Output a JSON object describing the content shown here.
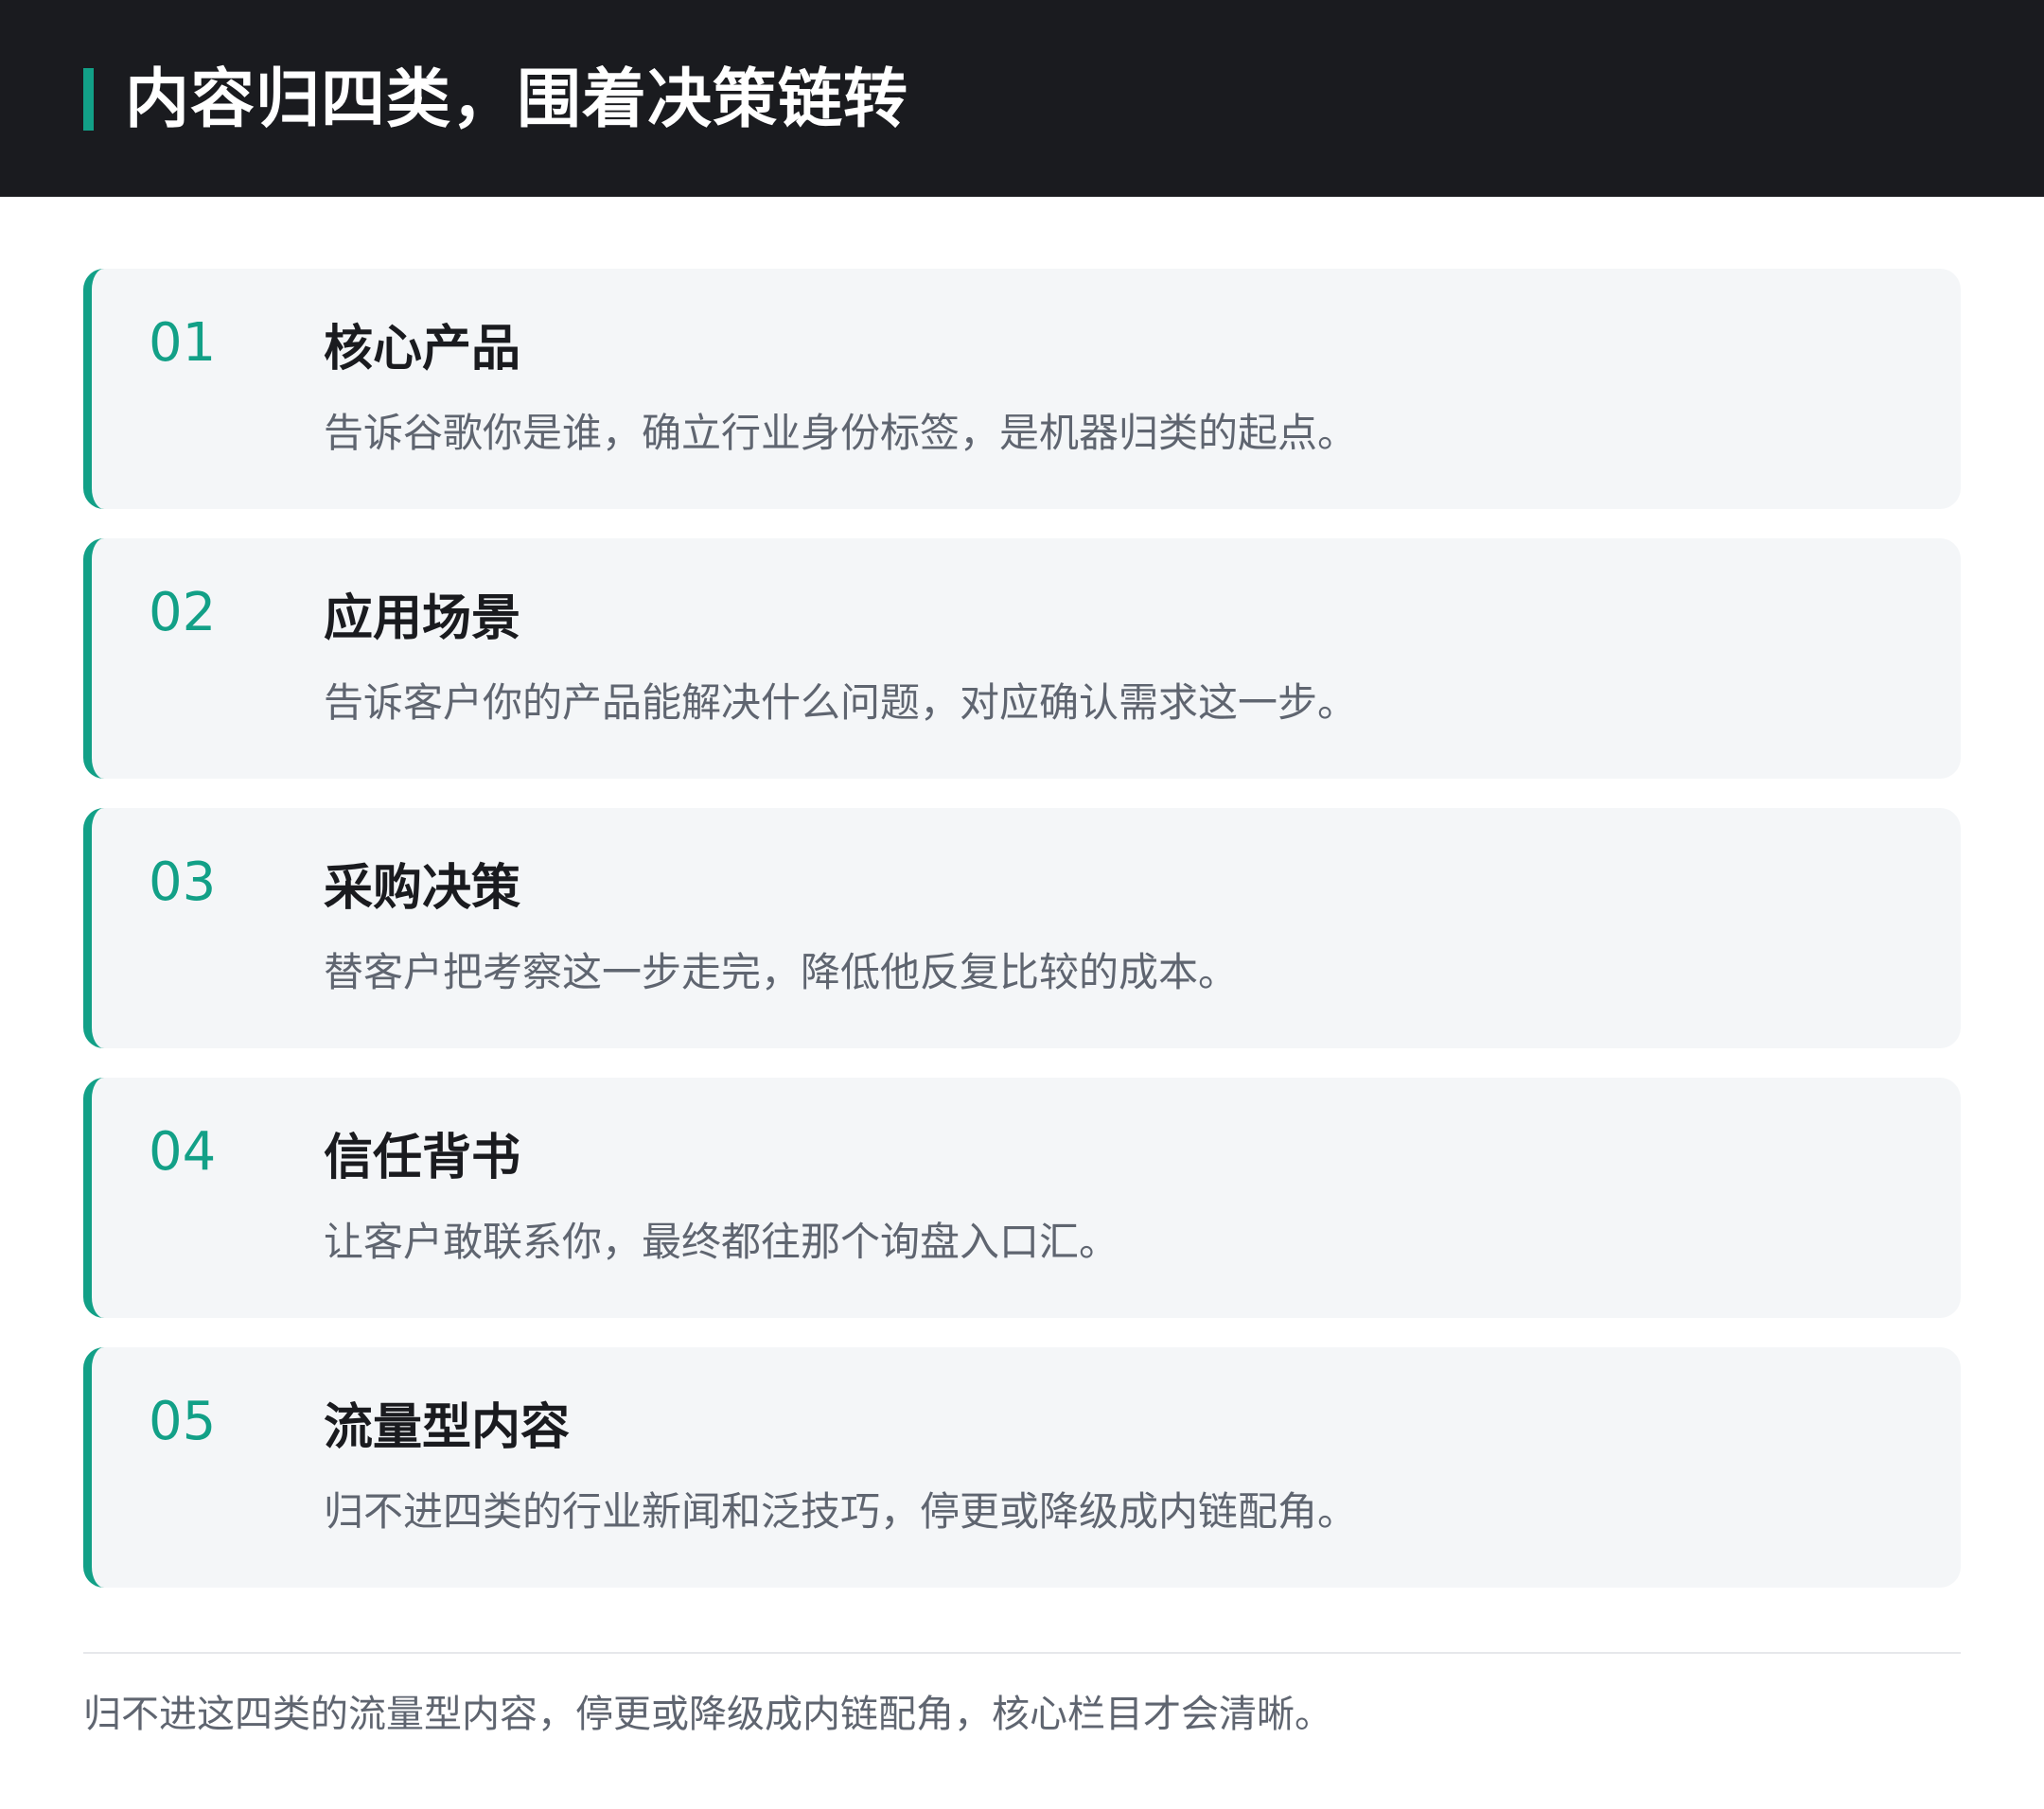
{
  "header": {
    "title": "内容归四类，围着决策链转"
  },
  "cards": [
    {
      "number": "01",
      "title": "核心产品",
      "description": "告诉谷歌你是谁，确立行业身份标签，是机器归类的起点。"
    },
    {
      "number": "02",
      "title": "应用场景",
      "description": "告诉客户你的产品能解决什么问题，对应确认需求这一步。"
    },
    {
      "number": "03",
      "title": "采购决策",
      "description": "替客户把考察这一步走完，降低他反复比较的成本。"
    },
    {
      "number": "04",
      "title": "信任背书",
      "description": "让客户敢联系你，最终都往那个询盘入口汇。"
    },
    {
      "number": "05",
      "title": "流量型内容",
      "description": "归不进四类的行业新闻和泛技巧，停更或降级成内链配角。"
    }
  ],
  "footer": {
    "note": "归不进这四类的流量型内容，停更或降级成内链配角，核心栏目才会清晰。"
  },
  "colors": {
    "accent": "#12a087",
    "header_bg": "#1a1b1f",
    "card_bg": "#f4f6f8"
  }
}
